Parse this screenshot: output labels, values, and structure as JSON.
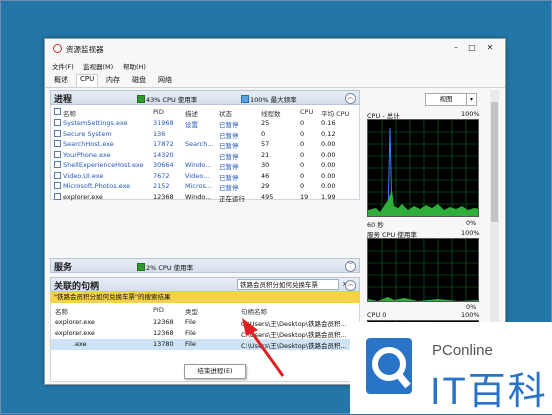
{
  "window": {
    "title": "资源监视器"
  },
  "menu": [
    "文件(F)",
    "监视器(M)",
    "帮助(H)"
  ],
  "tabs": [
    "概述",
    "CPU",
    "内存",
    "磁盘",
    "网络"
  ],
  "processes": {
    "title": "进程",
    "cpu_usage": "43% CPU 使用率",
    "max_freq": "100% 最大频率",
    "columns": [
      "名称",
      "PID",
      "描述",
      "状态",
      "线程数",
      "CPU",
      "平均 CPU"
    ],
    "rows": [
      [
        "SystemSettings.exe",
        "31968",
        "设置",
        "已暂停",
        "25",
        "0",
        "0.16"
      ],
      [
        "Secure System",
        "136",
        "",
        "已暂停",
        "0",
        "0",
        "0.12"
      ],
      [
        "SearchHost.exe",
        "17872",
        "Search...",
        "已暂停",
        "57",
        "0",
        "0.00"
      ],
      [
        "YourPhone.exe",
        "14320",
        "",
        "已暂停",
        "21",
        "0",
        "0.00"
      ],
      [
        "ShellExperienceHost.exe",
        "30664",
        "Windo...",
        "已暂停",
        "30",
        "0",
        "0.00"
      ],
      [
        "Video.UI.exe",
        "7672",
        "Video...",
        "已暂停",
        "46",
        "0",
        "0.00"
      ],
      [
        "Microsoft.Photos.exe",
        "2152",
        "Micros...",
        "已暂停",
        "29",
        "0",
        "0.00"
      ],
      [
        "explorer.exe",
        "12368",
        "Windo...",
        "正在运行",
        "495",
        "19",
        "1.99"
      ]
    ]
  },
  "services": {
    "title": "服务",
    "cpu_usage": "2% CPU 使用率"
  },
  "handles": {
    "title": "关联的句柄",
    "search_value": "铁路会员积分如何兑换车票",
    "search_clear": "×",
    "results_label": "\"铁路会员积分如何兑换车票\"的搜索结果",
    "columns": [
      "名称",
      "PID",
      "类型",
      "句柄名称"
    ],
    "rows": [
      [
        "explorer.exe",
        "12368",
        "File",
        "C:\\Users\\王\\Desktop\\铁路会员积..."
      ],
      [
        "explorer.exe",
        "12368",
        "File",
        "C:\\Users\\王\\Desktop\\铁路会员积..."
      ],
      [
        ".exe",
        "13780",
        "File",
        "C:\\Users\\王\\Desktop\\铁路会员积..."
      ]
    ]
  },
  "context_menu": {
    "end_process": "结束进程(E)"
  },
  "right_panel": {
    "view_button": "视图",
    "cpu_total": "CPU - 总计",
    "pct_100": "100%",
    "pct_0": "0%",
    "seconds_60": "60 秒",
    "service_cpu": "服务 CPU 使用率",
    "cpu0": "CPU 0"
  },
  "colors": {
    "accent_green": "#2e9a2e",
    "accent_blue": "#58a6e8",
    "highlight": "#f4d24a",
    "arrow": "#e02020",
    "watermark_blue": "#2a74c8"
  },
  "watermark": {
    "small": "PConline",
    "big": "IT百科"
  }
}
